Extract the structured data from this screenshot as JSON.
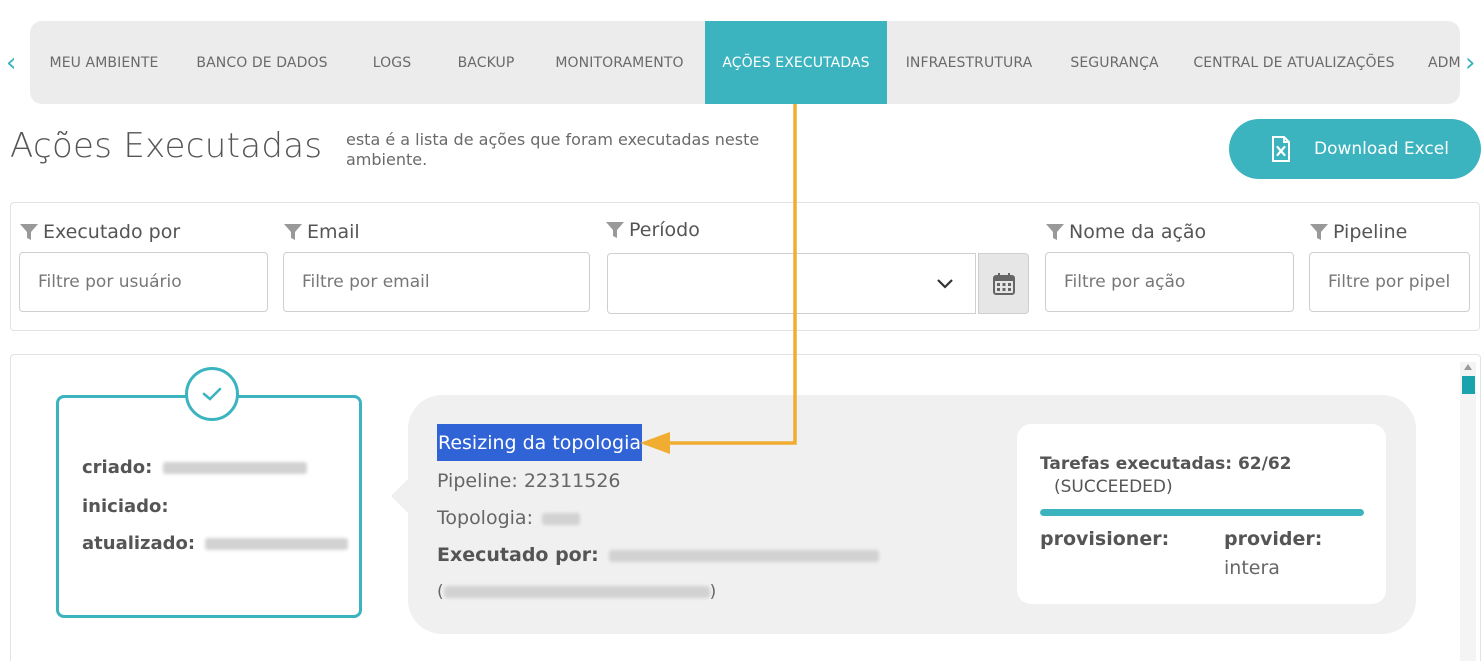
{
  "nav": {
    "tabs": [
      {
        "label": "MEU AMBIENTE",
        "active": false
      },
      {
        "label": "BANCO DE DADOS",
        "active": false
      },
      {
        "label": "LOGS",
        "active": false
      },
      {
        "label": "BACKUP",
        "active": false
      },
      {
        "label": "MONITORAMENTO",
        "active": false
      },
      {
        "label": "AÇÕES EXECUTADAS",
        "active": true
      },
      {
        "label": "INFRAESTRUTURA",
        "active": false
      },
      {
        "label": "SEGURANÇA",
        "active": false
      },
      {
        "label": "CENTRAL DE ATUALIZAÇÕES",
        "active": false
      },
      {
        "label": "ADM",
        "active": false
      }
    ],
    "prev_icon": "‹",
    "next_icon": "›"
  },
  "header": {
    "title": "Ações Executadas",
    "description": "esta é a lista de ações que foram executadas neste ambiente.",
    "download_label": "Download Excel"
  },
  "filters": {
    "executado_por": {
      "label": "Executado por",
      "placeholder": "Filtre por usuário"
    },
    "email": {
      "label": "Email",
      "placeholder": "Filtre por email"
    },
    "periodo": {
      "label": "Período",
      "value": ""
    },
    "nome_acao": {
      "label": "Nome da ação",
      "placeholder": "Filtre por ação"
    },
    "pipeline": {
      "label": "Pipeline",
      "placeholder": "Filtre por pipel"
    }
  },
  "action": {
    "status_labels": {
      "criado": "criado:",
      "iniciado": "iniciado:",
      "atualizado": "atualizado:"
    },
    "name": "Resizing da topologia",
    "pipeline_label": "Pipeline:",
    "pipeline_value": "22311526",
    "topologia_label": "Topologia:",
    "executado_por_label": "Executado por:",
    "email_open": "(",
    "email_close": ")",
    "tasks_label": "Tarefas executadas: 62/62",
    "tasks_status": "(SUCCEEDED)",
    "tasks_progress": 1.0,
    "provisioner_label": "provisioner:",
    "provider_label": "provider:",
    "provider_value": "intera"
  },
  "colors": {
    "accent": "#3bb4bf",
    "highlight": "#2f63d6",
    "annotation": "#f0ad32"
  }
}
